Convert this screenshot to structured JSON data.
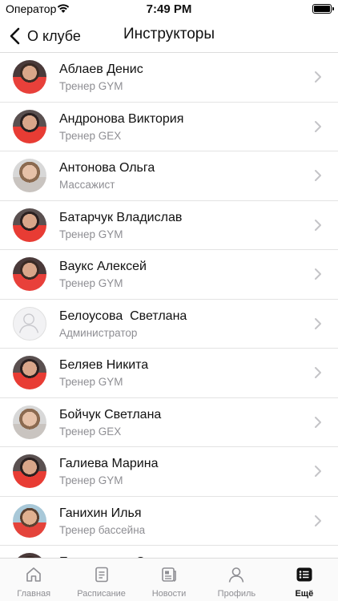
{
  "status_bar": {
    "carrier": "Оператор",
    "time": "7:49 PM"
  },
  "nav": {
    "back_label": "О клубе",
    "title": "Инструкторы"
  },
  "instructors": [
    {
      "name": "Аблаев Денис",
      "role": "Тренер GYM",
      "avatar": "photo"
    },
    {
      "name": "Андронова Виктория",
      "role": "Тренер GEX",
      "avatar": "photo"
    },
    {
      "name": "Антонова Ольга",
      "role": "Массажист",
      "avatar": "photo"
    },
    {
      "name": "Батарчук Владислав",
      "role": "Тренер GYM",
      "avatar": "photo"
    },
    {
      "name": "Bаукс Алексей",
      "role": "Тренер GYM",
      "avatar": "photo"
    },
    {
      "name": "Белоусова  Светлана",
      "role": "Администратор",
      "avatar": "placeholder"
    },
    {
      "name": "Беляев Никита",
      "role": "Тренер GYM",
      "avatar": "photo"
    },
    {
      "name": "Бойчук Светлана",
      "role": "Тренер GEX",
      "avatar": "photo"
    },
    {
      "name": "Галиева Марина",
      "role": "Тренер GYM",
      "avatar": "photo"
    },
    {
      "name": "Ганихин Илья",
      "role": "Тренер бассейна",
      "avatar": "photo"
    },
    {
      "name": "Ермоленков Степан",
      "role": "",
      "avatar": "photo"
    }
  ],
  "tab_bar": {
    "tabs": [
      {
        "label": "Главная",
        "icon": "home-icon",
        "active": false
      },
      {
        "label": "Расписание",
        "icon": "schedule-icon",
        "active": false
      },
      {
        "label": "Новости",
        "icon": "news-icon",
        "active": false
      },
      {
        "label": "Профиль",
        "icon": "profile-icon",
        "active": false
      },
      {
        "label": "Ещё",
        "icon": "more-icon",
        "active": true
      }
    ]
  },
  "colors": {
    "accent_red": "#e8403a",
    "secondary_text": "#8e8e93"
  }
}
